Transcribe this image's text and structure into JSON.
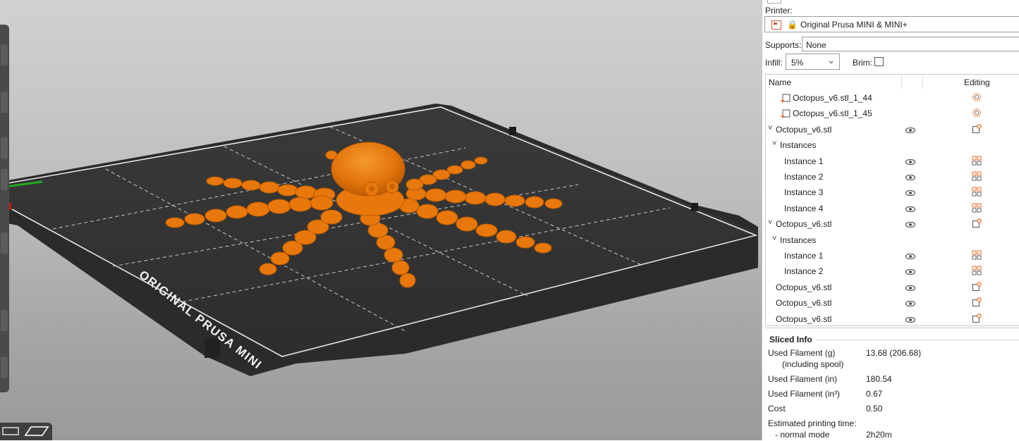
{
  "sidebar": {
    "printer_label": "Printer:",
    "printer_value": "Original Prusa MINI & MINI+",
    "supports_label": "Supports:",
    "supports_value": "None",
    "infill_label": "Infill:",
    "infill_value": "5%",
    "brim_label": "Brim:",
    "brim_checked": false
  },
  "object_list": {
    "col_name": "Name",
    "col_editing": "Editing",
    "rows": [
      {
        "label": "Octopus_v6.stl_1_44",
        "level": "modifier",
        "icon": "modifier-icon",
        "action": "settings-gear-icon"
      },
      {
        "label": "Octopus_v6.stl_1_45",
        "level": "modifier",
        "icon": "modifier-icon",
        "action": "settings-gear-icon"
      },
      {
        "label": "Octopus_v6.stl",
        "level": "object",
        "expanded": true,
        "action": "edit-object-icon"
      },
      {
        "label": "Instances",
        "level": "group",
        "expanded": true
      },
      {
        "label": "Instance 1",
        "level": "instance",
        "action": "instance-icon"
      },
      {
        "label": "Instance 2",
        "level": "instance",
        "action": "instance-icon"
      },
      {
        "label": "Instance 3",
        "level": "instance",
        "action": "instance-icon"
      },
      {
        "label": "Instance 4",
        "level": "instance",
        "action": "instance-icon"
      },
      {
        "label": "Octopus_v6.stl",
        "level": "object",
        "expanded": true,
        "action": "edit-object-icon"
      },
      {
        "label": "Instances",
        "level": "group",
        "expanded": true
      },
      {
        "label": "Instance 1",
        "level": "instance",
        "action": "instance-icon"
      },
      {
        "label": "Instance 2",
        "level": "instance",
        "action": "instance-icon"
      },
      {
        "label": "Octopus_v6.stl",
        "level": "object",
        "action": "edit-object-icon"
      },
      {
        "label": "Octopus_v6.stl",
        "level": "object",
        "action": "edit-object-icon"
      },
      {
        "label": "Octopus_v6.stl",
        "level": "object",
        "action": "edit-object-icon"
      }
    ]
  },
  "sliced_info": {
    "title": "Sliced Info",
    "used_filament_g_label": "Used Filament (g)",
    "used_filament_g_sub": "(including spool)",
    "used_filament_g_value": "13.68 (206.68)",
    "used_filament_in_label": "Used Filament (in)",
    "used_filament_in_value": "180.54",
    "used_filament_in3_label": "Used Filament (in³)",
    "used_filament_in3_value": "0.67",
    "cost_label": "Cost",
    "cost_value": "0.50",
    "est_time_label": "Estimated printing time:",
    "normal_mode_label": "- normal mode",
    "normal_mode_value": "2h20m"
  },
  "viewport": {
    "bed_label": "ORIGINAL PRUSA MINI",
    "model_color": "#ed7d0a",
    "bed_color": "#2f2f2f"
  },
  "colors": {
    "accent_orange": "#ed6b21"
  }
}
